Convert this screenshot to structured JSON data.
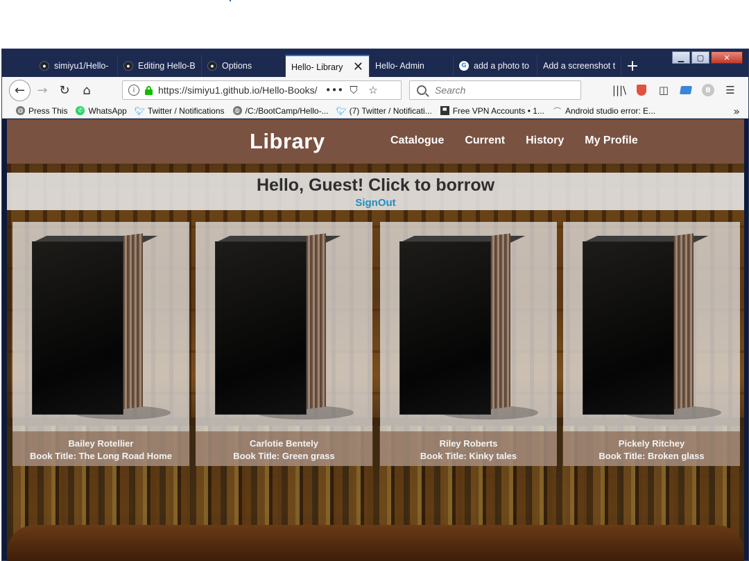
{
  "browser": {
    "tabs": [
      {
        "label": "simiyu1/Hello-",
        "icon": "github-icon",
        "active": false
      },
      {
        "label": "Editing Hello-B",
        "icon": "github-icon",
        "active": false
      },
      {
        "label": "Options",
        "icon": "github-icon",
        "active": false
      },
      {
        "label": "Hello- Library",
        "icon": "",
        "active": true
      },
      {
        "label": "Hello- Admin",
        "icon": "",
        "active": false
      },
      {
        "label": "add a photo to",
        "icon": "google-icon",
        "active": false
      },
      {
        "label": "Add a screenshot to",
        "icon": "",
        "active": false
      }
    ],
    "url": "https://simiyu1.github.io/Hello-Books/",
    "search_placeholder": "Search",
    "bookmarks": [
      {
        "label": "Press This",
        "icon": "globe-icon"
      },
      {
        "label": "WhatsApp",
        "icon": "whatsapp-icon"
      },
      {
        "label": "Twitter / Notifications",
        "icon": "twitter-icon"
      },
      {
        "label": "/C:/BootCamp/Hello-...",
        "icon": "globe-icon"
      },
      {
        "label": "(7) Twitter / Notificati...",
        "icon": "twitter-icon"
      },
      {
        "label": "Free VPN Accounts • 1...",
        "icon": "vpn-icon"
      },
      {
        "label": "Android studio error: E...",
        "icon": "android-icon"
      }
    ]
  },
  "site": {
    "brand": "Library",
    "nav": [
      "Catalogue",
      "Current",
      "History",
      "My Profile"
    ],
    "greeting": "Hello, Guest! Click to borrow",
    "signout": "SignOut",
    "books": [
      {
        "author": "Bailey Rotellier",
        "title_prefix": "Book Title: ",
        "title": "The Long Road Home"
      },
      {
        "author": "Carlotie Bentely",
        "title_prefix": "Book Title: ",
        "title": "Green grass"
      },
      {
        "author": "Riley Roberts",
        "title_prefix": "Book Title: ",
        "title": "Kinky tales"
      },
      {
        "author": "Pickely Ritchey",
        "title_prefix": "Book Title: ",
        "title": "Broken glass"
      }
    ]
  },
  "colors": {
    "site_nav_bg": "#7a5241",
    "signout_link": "#1e8fc4",
    "browser_frame": "#1d2a50"
  }
}
